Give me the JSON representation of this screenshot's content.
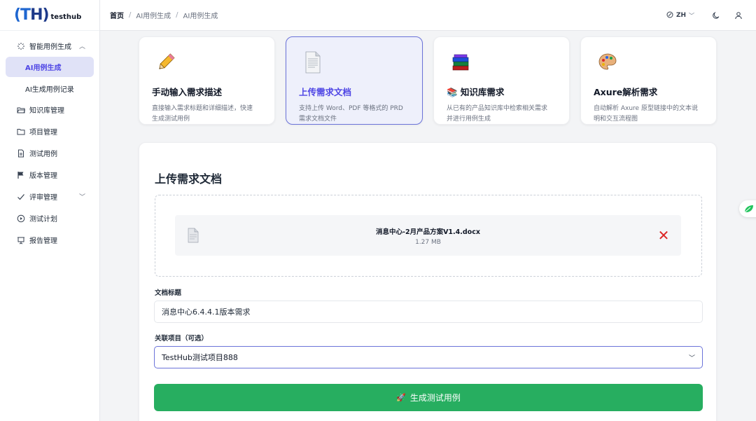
{
  "app": {
    "logo_mark": "(T",
    "logo_mark_b": "H)",
    "logo_text": "testhub"
  },
  "sidebar": {
    "items": [
      {
        "label": "智能用例生成",
        "icon": "sparkle-icon",
        "expanded": true,
        "children": [
          {
            "label": "AI用例生成",
            "active": true
          },
          {
            "label": "AI生成用例记录",
            "active": false
          }
        ]
      },
      {
        "label": "知识库管理",
        "icon": "folder-open-icon"
      },
      {
        "label": "项目管理",
        "icon": "folder-icon"
      },
      {
        "label": "测试用例",
        "icon": "document-icon"
      },
      {
        "label": "版本管理",
        "icon": "flag-icon"
      },
      {
        "label": "评审管理",
        "icon": "check-icon",
        "expanded": false
      },
      {
        "label": "测试计划",
        "icon": "play-circle-icon"
      },
      {
        "label": "报告管理",
        "icon": "presentation-icon"
      }
    ]
  },
  "header": {
    "breadcrumb": [
      "首页",
      "AI用例生成",
      "AI用例生成"
    ],
    "lang": "ZH"
  },
  "cards": [
    {
      "emoji": "✏️",
      "icon": "pencil-icon",
      "title": "手动输入需求描述",
      "desc1": "直接输入需求标题和详细描述，快速",
      "desc2": "生成测试用例",
      "active": false
    },
    {
      "emoji": "📄",
      "icon": "document-page-icon",
      "title": "上传需求文档",
      "desc1": "支持上传 Word、PDF 等格式的 PRD",
      "desc2": "需求文档文件",
      "active": true
    },
    {
      "emoji": "📚",
      "icon": "books-icon",
      "title": "📚 知识库需求",
      "desc1": "从已有的产品知识库中检索相关需求",
      "desc2": "并进行用例生成",
      "active": false
    },
    {
      "emoji": "🎨",
      "icon": "palette-icon",
      "title": "Axure解析需求",
      "desc1": "自动解析 Axure 原型链接中的文本说",
      "desc2": "明和交互流程图",
      "active": false
    }
  ],
  "panel": {
    "title": "上传需求文档",
    "file": {
      "name": "消息中心-2月产品方案V1.4.docx",
      "size": "1.27 MB"
    },
    "doc_title_label": "文档标题",
    "doc_title_value": "消息中心6.4.4.1版本需求",
    "project_label": "关联项目（可选）",
    "project_value": "TestHub测试项目888",
    "generate_label": "生成测试用例",
    "generate_emoji": "🚀"
  },
  "colors": {
    "accent": "#4f46e5",
    "primary_button": "#27ae60",
    "delete": "#dc2626"
  }
}
